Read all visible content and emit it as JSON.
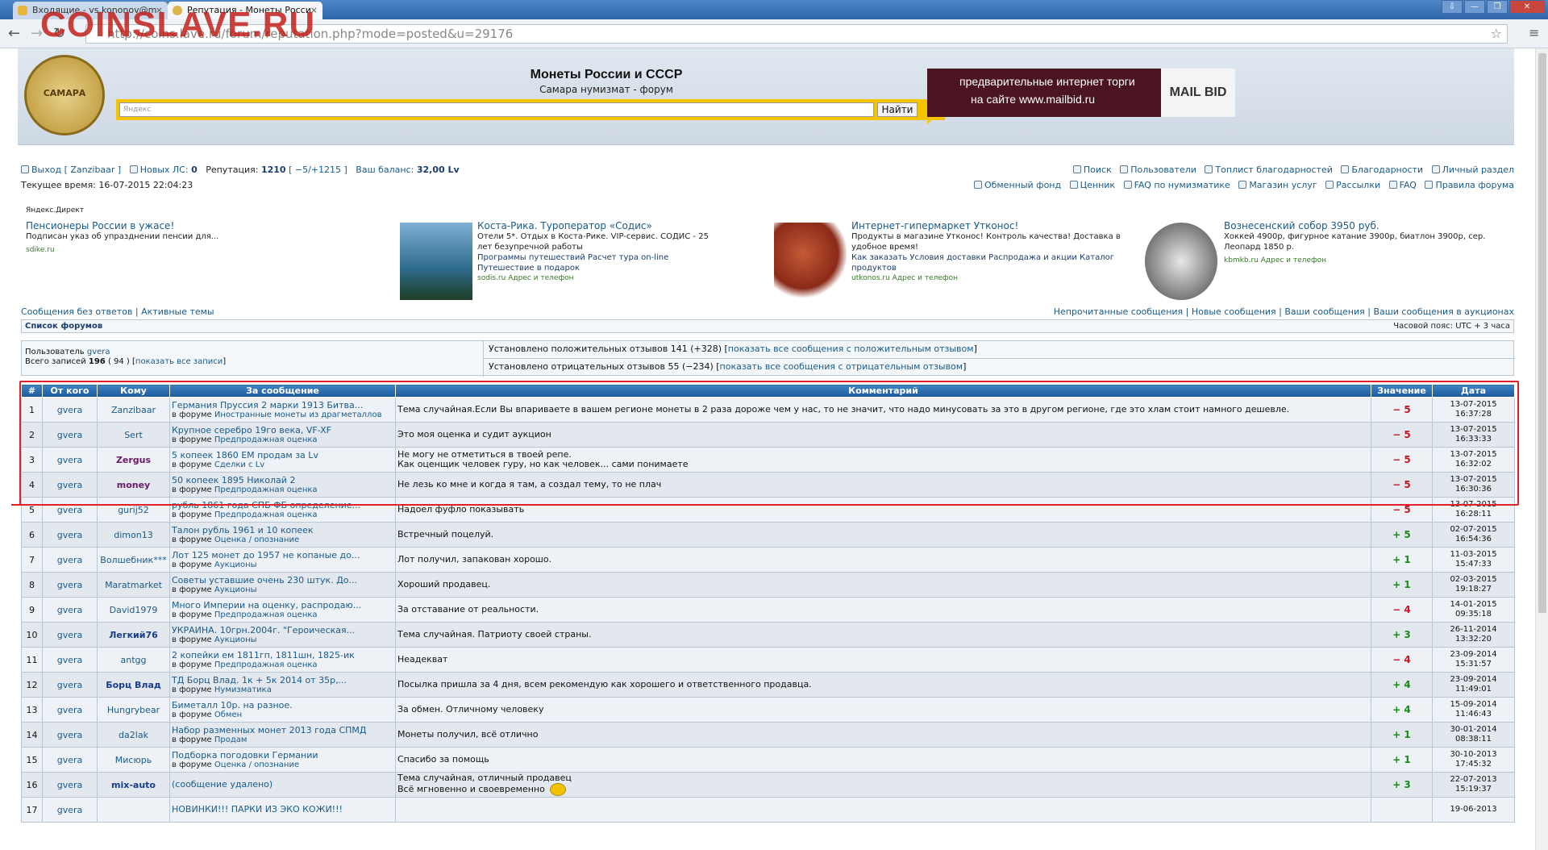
{
  "browser": {
    "tabs": [
      {
        "label": "Входящие - vs.kononov@m",
        "active": false
      },
      {
        "label": "Репутация - Монеты Росси",
        "active": true
      }
    ],
    "window_buttons": [
      "⇩",
      "—",
      "❐",
      "✕"
    ],
    "address": "http://coins.lave.ru/forum/reputation.php?mode=posted&u=29176",
    "watermark": "COINSLAVE.RU"
  },
  "header": {
    "logo_text": "САМАРА",
    "title": "Монеты России и СССР",
    "subtitle": "Самара нумизмат - форум",
    "search_placeholder": "Яндекс",
    "search_button": "Найти",
    "banner_line1": "предварительные интернет торги",
    "banner_line2": "на сайте www.mailbid.ru",
    "banner_logo": "MAIL BID"
  },
  "userbar": {
    "logout": "Выход [ Zanzibaar ]",
    "new_pm_label": "Новых ЛС:",
    "new_pm_count": "0",
    "reputation_label": "Репутация:",
    "reputation_value": "1210",
    "reputation_detail": "[ −5/+1215 ]",
    "balance_label": "Ваш баланс:",
    "balance_value": "32,00 Lv",
    "time_label": "Текущее время:",
    "time_value": "16-07-2015 22:04:23",
    "nav_top": [
      "Поиск",
      "Пользователи",
      "Топлист благодарностей",
      "Благодарности",
      "Личный раздел"
    ],
    "nav_bottom": [
      "Обменный фонд",
      "Ценник",
      "FAQ по нумизматике",
      "Магазин услуг",
      "Рассылки",
      "FAQ",
      "Правила форума"
    ]
  },
  "ads": {
    "label": "Яндекс.Директ",
    "items": [
      {
        "title": "Пенсионеры России в ужасе!",
        "desc": "Подписан указ об упразднении пенсии для...",
        "links": "",
        "domain": "sdike.ru"
      },
      {
        "title": "Коста-Рика. Туроператор «Содис»",
        "desc": "Отели 5*. Отдых в Коста-Рике. VIP-сервис. СОДИС - 25 лет безупречной работы",
        "links": "Программы путешествий   Расчет тура on-line   Путешествие в подарок",
        "domain": "sodis.ru   Адрес и телефон"
      },
      {
        "title": "Интернет-гипермаркет Утконос!",
        "desc": "Продукты в магазине Утконос! Контроль качества! Доставка в удобное время!",
        "links": "Как заказать   Условия доставки   Распродажа и акции   Каталог продуктов",
        "domain": "utkonos.ru   Адрес и телефон"
      },
      {
        "title": "Вознесенский собор 3950 руб.",
        "desc": "Хоккей 4900р, фигурное катание 3900р, биатлон 3900р, сер. Леопард 1850 р.",
        "links": "",
        "domain": "kbmkb.ru   Адрес и телефон"
      }
    ]
  },
  "links": {
    "left": "Сообщения без ответов | Активные темы",
    "right": "Непрочитанные сообщения | Новые сообщения | Ваши сообщения | Ваши сообщения в аукционах",
    "forum_list": "Список форумов",
    "timezone": "Часовой пояс: UTC + 3 часа"
  },
  "stats": {
    "user_label": "Пользователь",
    "user_name": "gvera",
    "total_label": "Всего записей",
    "total_value": "196",
    "total_detail": "( 94 ) [",
    "show_all": "показать все записи",
    "positive_text": "Установлено положительных отзывов 141 (+328) [",
    "positive_link": "показать все сообщения с положительным отзывом",
    "negative_text": "Установлено отрицательных отзывов 55 (−234) [",
    "negative_link": "показать все сообщения с отрицательным отзывом"
  },
  "table": {
    "headers": [
      "#",
      "От кого",
      "Кому",
      "За сообщение",
      "Комментарий",
      "Значение",
      "Дата"
    ],
    "rows": [
      {
        "n": "1",
        "from": "gvera",
        "to": "Zanzibaar",
        "to_bold": false,
        "post": "Германия Пруссия 2 марки 1913 Битва...",
        "forum": "Иностранные монеты из драгметаллов",
        "comment": "Тема случайная.Если Вы впариваете в вашем регионе монеты в 2 раза дороже чем у нас, то не значит, что надо минусовать за это в другом регионе, где это хлам стоит намного дешевле.",
        "value": "− 5",
        "sign": "neg",
        "date": "13-07-2015",
        "time": "16:37:28"
      },
      {
        "n": "2",
        "from": "gvera",
        "to": "Sert",
        "to_bold": false,
        "post": "Крупное серебро 19го века, VF-XF",
        "forum": "Предпродажная оценка",
        "comment": "Это моя оценка и судит аукцион",
        "value": "− 5",
        "sign": "neg",
        "date": "13-07-2015",
        "time": "16:33:33"
      },
      {
        "n": "3",
        "from": "gvera",
        "to": "Zergus",
        "to_bold": true,
        "to_color": "#6a1a6a",
        "post": "5 копеек 1860 ЕМ продам за Lv",
        "forum": "Сделки с Lv",
        "comment": "Не могу не отметиться в твоей репе.\nКак оценщик человек гуру, но как человек... сами понимаете",
        "value": "− 5",
        "sign": "neg",
        "date": "13-07-2015",
        "time": "16:32:02"
      },
      {
        "n": "4",
        "from": "gvera",
        "to": "money",
        "to_bold": true,
        "to_color": "#6a1a6a",
        "post": "50 копеек 1895 Николай 2",
        "forum": "Предпродажная оценка",
        "comment": "Не лезь ко мне и когда я там, а создал тему, то не плач",
        "value": "− 5",
        "sign": "neg",
        "date": "13-07-2015",
        "time": "16:30:36"
      },
      {
        "n": "5",
        "from": "gvera",
        "to": "gurij52",
        "to_bold": false,
        "post": "рубль 1861 года СПБ ФБ определение...",
        "forum": "Предпродажная оценка",
        "comment": "Надоел фуфло показывать",
        "value": "− 5",
        "sign": "neg",
        "date": "13-07-2015",
        "time": "16:28:11"
      },
      {
        "n": "6",
        "from": "gvera",
        "to": "dimon13",
        "to_bold": false,
        "post": "Талон рубль 1961 и 10 копеек",
        "forum": "Оценка / опознание",
        "comment": "Встречный поцелуй.",
        "value": "+ 5",
        "sign": "pos",
        "date": "02-07-2015",
        "time": "16:54:36"
      },
      {
        "n": "7",
        "from": "gvera",
        "to": "Волшебник***",
        "to_bold": false,
        "post": "Лот 125 монет до 1957 не копаные до...",
        "forum": "Аукционы",
        "comment": "Лот получил, запакован хорошо.",
        "value": "+ 1",
        "sign": "pos",
        "date": "11-03-2015",
        "time": "15:47:33"
      },
      {
        "n": "8",
        "from": "gvera",
        "to": "Maratmarket",
        "to_bold": false,
        "post": "Советы уставшие очень 230 штук. До...",
        "forum": "Аукционы",
        "comment": "Хороший продавец.",
        "value": "+ 1",
        "sign": "pos",
        "date": "02-03-2015",
        "time": "19:18:27"
      },
      {
        "n": "9",
        "from": "gvera",
        "to": "David1979",
        "to_bold": false,
        "post": "Много Империи на оценку, распродаю...",
        "forum": "Предпродажная оценка",
        "comment": "За отставание от реальности.",
        "value": "− 4",
        "sign": "neg",
        "date": "14-01-2015",
        "time": "09:35:18"
      },
      {
        "n": "10",
        "from": "gvera",
        "to": "Легкий76",
        "to_bold": true,
        "to_color": "#1a3d8e",
        "post": "УКРАИНА. 10грн.2004г. \"Героическая...",
        "forum": "Аукционы",
        "comment": "Тема случайная. Патриоту своей страны.",
        "value": "+ 3",
        "sign": "pos",
        "date": "26-11-2014",
        "time": "13:32:20"
      },
      {
        "n": "11",
        "from": "gvera",
        "to": "antgg",
        "to_bold": false,
        "post": "2 копейки ем 1811гп, 1811шн, 1825-ик",
        "forum": "Предпродажная оценка",
        "comment": "Неадекват",
        "value": "− 4",
        "sign": "neg",
        "date": "23-09-2014",
        "time": "15:31:57"
      },
      {
        "n": "12",
        "from": "gvera",
        "to": "Борц Влад",
        "to_bold": true,
        "to_color": "#1a3d8e",
        "post": "ТД Борц Влад. 1к + 5к 2014 от 35р,...",
        "forum": "Нумизматика",
        "comment": "Посылка пришла за 4 дня, всем рекомендую как хорошего и ответственного продавца.",
        "value": "+ 4",
        "sign": "pos",
        "date": "23-09-2014",
        "time": "11:49:01"
      },
      {
        "n": "13",
        "from": "gvera",
        "to": "Hungrybear",
        "to_bold": false,
        "post": "Биметалл 10р. на разное.",
        "forum": "Обмен",
        "comment": "За обмен. Отличному человеку",
        "value": "+ 4",
        "sign": "pos",
        "date": "15-09-2014",
        "time": "11:46:43"
      },
      {
        "n": "14",
        "from": "gvera",
        "to": "da2lak",
        "to_bold": false,
        "post": "Набор разменных монет 2013 года СПМД",
        "forum": "Продам",
        "comment": "Монеты получил, всё отлично",
        "value": "+ 1",
        "sign": "pos",
        "date": "30-01-2014",
        "time": "08:38:11"
      },
      {
        "n": "15",
        "from": "gvera",
        "to": "Мисюрь",
        "to_bold": false,
        "post": "Подборка погодовки Германии",
        "forum": "Оценка / опознание",
        "comment": "Спасибо за помощь",
        "value": "+ 1",
        "sign": "pos",
        "date": "30-10-2013",
        "time": "17:45:32"
      },
      {
        "n": "16",
        "from": "gvera",
        "to": "mix-auto",
        "to_bold": true,
        "to_color": "#1a3d8e",
        "post": "(сообщение удалено)",
        "forum": "",
        "comment": "Тема случайная, отличный продавец\nВсё мгновенно и своевременно",
        "value": "+ 3",
        "sign": "pos",
        "date": "22-07-2013",
        "time": "15:19:37",
        "smiley": true
      },
      {
        "n": "17",
        "from": "gvera",
        "to": "",
        "to_bold": false,
        "post": "НОВИНКИ!!! ПАРКИ ИЗ ЭКО КОЖИ!!!",
        "forum": "",
        "comment": "",
        "value": "",
        "sign": "pos",
        "date": "19-06-2013",
        "time": ""
      }
    ],
    "forum_prefix": "в форуме"
  },
  "colors": {
    "negative": "#c8141e",
    "positive": "#1a8a1a",
    "highlight": "#e0202a",
    "header_blue": "#1d5a9c"
  }
}
